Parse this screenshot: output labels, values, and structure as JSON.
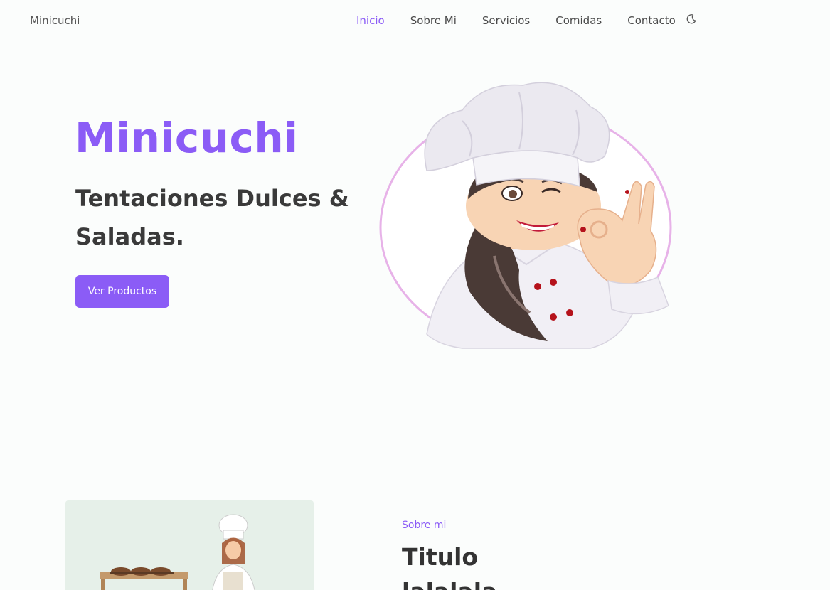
{
  "nav": {
    "brand": "Minicuchi",
    "items": [
      {
        "label": "Inicio",
        "active": true
      },
      {
        "label": "Sobre Mi"
      },
      {
        "label": "Servicios"
      },
      {
        "label": "Comidas"
      },
      {
        "label": "Contacto"
      }
    ],
    "theme_icon": "moon-icon"
  },
  "hero": {
    "title": "Minicuchi",
    "subtitle": "Tentaciones Dulces & Saladas.",
    "button": "Ver Productos",
    "image": "chef-woman-winking-ok-gesture"
  },
  "about": {
    "label": "Sobre mi",
    "title": "Titulo",
    "line2": "lalalala",
    "image": "chef-with-bread-illustration"
  },
  "colors": {
    "accent": "#8b5cf6",
    "text": "#3a3a3a",
    "background": "#fbfdfc",
    "ring": "#e7b2e8"
  }
}
